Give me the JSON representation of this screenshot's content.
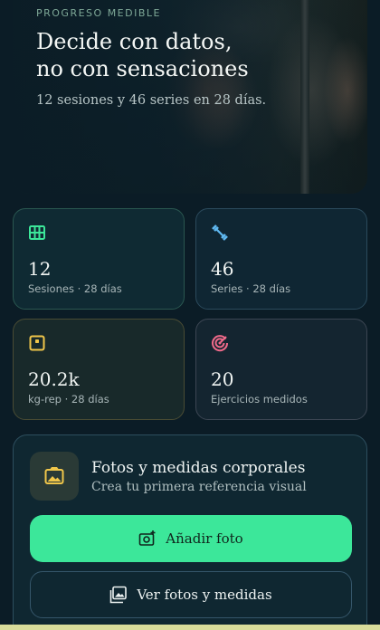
{
  "hero": {
    "eyebrow": "PROGRESO MEDIBLE",
    "headline_line1": "Decide con datos,",
    "headline_line2": "no con sensaciones",
    "subline": "12 sesiones y 46 series en 28 días."
  },
  "stats": [
    {
      "value": "12",
      "label": "Sesiones · 28 días",
      "icon": "grid-icon",
      "color": "#3ce79a"
    },
    {
      "value": "46",
      "label": "Series · 28 días",
      "icon": "dumbbell-icon",
      "color": "#5fb8f0"
    },
    {
      "value": "20.2k",
      "label": "kg-rep · 28 días",
      "icon": "scale-icon",
      "color": "#f0c64a"
    },
    {
      "value": "20",
      "label": "Ejercicios medidos",
      "icon": "target-icon",
      "color": "#f06a8a"
    }
  ],
  "photos_panel": {
    "title": "Fotos y medidas corporales",
    "subtitle": "Crea tu primera referencia visual",
    "primary_button": "Añadir foto",
    "secondary_button": "Ver fotos y medidas",
    "thumb_icon": "photo-icon",
    "thumb_icon_color": "#f0c64a"
  },
  "colors": {
    "accent": "#3ce79a",
    "background": "#0b1c26"
  }
}
